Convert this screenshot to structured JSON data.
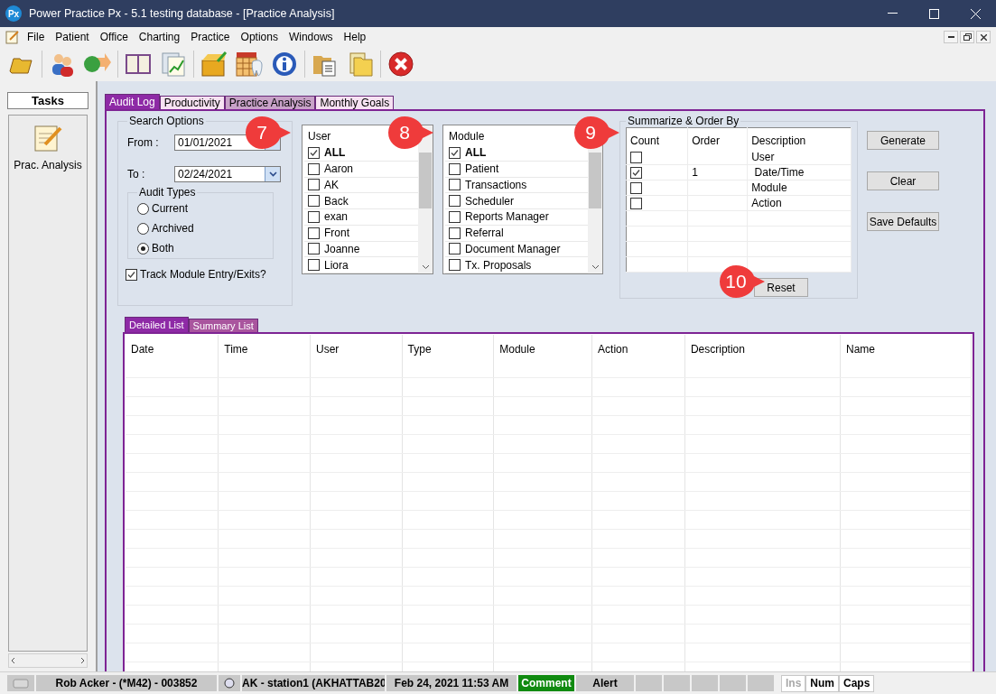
{
  "window": {
    "logo": "Px",
    "title": "Power Practice Px - 5.1 testing database - [Practice Analysis]"
  },
  "menu": [
    "File",
    "Patient",
    "Office",
    "Charting",
    "Practice",
    "Options",
    "Windows",
    "Help"
  ],
  "tasks": {
    "title": "Tasks",
    "items": [
      "Prac. Analysis"
    ]
  },
  "tabs": [
    {
      "label": "Audit Log",
      "selected": true
    },
    {
      "label": "Productivity",
      "selected": false
    },
    {
      "label": "Practice Analysis",
      "selected": false
    },
    {
      "label": "Monthly Goals",
      "selected": false
    }
  ],
  "search_options": {
    "title": "Search Options",
    "from": {
      "label": "From :",
      "value": "01/01/2021"
    },
    "to": {
      "label": "To :",
      "value": "02/24/2021"
    },
    "audit_types": {
      "title": "Audit Types",
      "options": [
        {
          "label": "Current",
          "selected": false
        },
        {
          "label": "Archived",
          "selected": false
        },
        {
          "label": "Both",
          "selected": true
        }
      ]
    },
    "track_module": {
      "label": "Track Module Entry/Exits?",
      "checked": true
    }
  },
  "user_list": {
    "header": "User",
    "items": [
      {
        "label": "ALL",
        "checked": true
      },
      {
        "label": "Aaron",
        "checked": false
      },
      {
        "label": "AK",
        "checked": false
      },
      {
        "label": "Back",
        "checked": false
      },
      {
        "label": "exan",
        "checked": false
      },
      {
        "label": "Front",
        "checked": false
      },
      {
        "label": "Joanne",
        "checked": false
      },
      {
        "label": "Liora",
        "checked": false
      }
    ]
  },
  "module_list": {
    "header": "Module",
    "items": [
      {
        "label": "ALL",
        "checked": true
      },
      {
        "label": "Patient",
        "checked": false
      },
      {
        "label": "Transactions",
        "checked": false
      },
      {
        "label": "Scheduler",
        "checked": false
      },
      {
        "label": "Reports Manager",
        "checked": false
      },
      {
        "label": "Referral",
        "checked": false
      },
      {
        "label": "Document Manager",
        "checked": false
      },
      {
        "label": "Tx. Proposals",
        "checked": false
      }
    ]
  },
  "summarize": {
    "title": "Summarize & Order By",
    "columns": [
      "Count",
      "Order",
      "Description"
    ],
    "rows": [
      {
        "checked": false,
        "description": "User"
      },
      {
        "checked": true,
        "order": "1",
        "description": " Date/Time"
      },
      {
        "checked": false,
        "description": "Module"
      },
      {
        "checked": false,
        "description": "Action"
      }
    ]
  },
  "buttons": [
    "Generate",
    "Clear",
    "Save Defaults"
  ],
  "reset_button": "Reset",
  "result_tabs": [
    {
      "label": "Detailed List",
      "selected": true
    },
    {
      "label": "Summary List",
      "selected": false
    }
  ],
  "results": {
    "columns": [
      "Date",
      "Time",
      "User",
      "Type",
      "Module",
      "Action",
      "Description",
      "Name"
    ]
  },
  "callouts": [
    "7",
    "8",
    "9",
    "10"
  ],
  "status_bar": {
    "user": "Rob Acker - (*M42) - 003852",
    "station": "AK - station1 (AKHATTAB20",
    "datetime": "Feb 24, 2021 11:53 AM",
    "comment": "Comment",
    "alert": "Alert",
    "indicators": [
      {
        "label": "Ins",
        "on": false
      },
      {
        "label": "Num",
        "on": true
      },
      {
        "label": "Caps",
        "on": true
      }
    ]
  }
}
